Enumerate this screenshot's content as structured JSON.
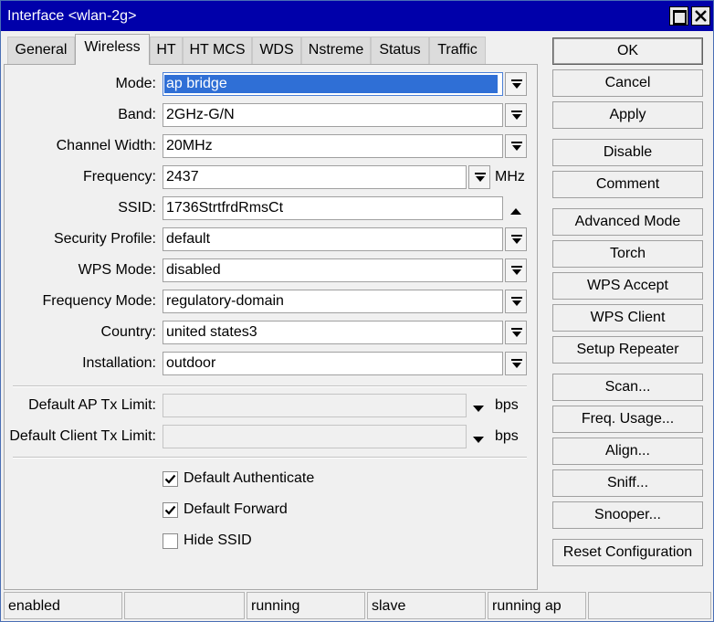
{
  "window": {
    "title": "Interface <wlan-2g>"
  },
  "tabs": [
    {
      "label": "General"
    },
    {
      "label": "Wireless"
    },
    {
      "label": "HT"
    },
    {
      "label": "HT MCS"
    },
    {
      "label": "WDS"
    },
    {
      "label": "Nstreme"
    },
    {
      "label": "Status"
    },
    {
      "label": "Traffic"
    }
  ],
  "active_tab": "Wireless",
  "form": {
    "mode": {
      "label": "Mode:",
      "value": "ap bridge"
    },
    "band": {
      "label": "Band:",
      "value": "2GHz-G/N"
    },
    "channel_width": {
      "label": "Channel Width:",
      "value": "20MHz"
    },
    "frequency": {
      "label": "Frequency:",
      "value": "2437",
      "unit": "MHz"
    },
    "ssid": {
      "label": "SSID:",
      "value": "1736StrtfrdRmsCt"
    },
    "security_profile": {
      "label": "Security Profile:",
      "value": "default"
    },
    "wps_mode": {
      "label": "WPS Mode:",
      "value": "disabled"
    },
    "frequency_mode": {
      "label": "Frequency Mode:",
      "value": "regulatory-domain"
    },
    "country": {
      "label": "Country:",
      "value": "united states3"
    },
    "installation": {
      "label": "Installation:",
      "value": "outdoor"
    },
    "default_ap_tx_limit": {
      "label": "Default AP Tx Limit:",
      "value": "",
      "unit": "bps"
    },
    "default_client_tx_limit": {
      "label": "Default Client Tx Limit:",
      "value": "",
      "unit": "bps"
    }
  },
  "checkboxes": {
    "default_authenticate": {
      "label": "Default Authenticate",
      "checked": true
    },
    "default_forward": {
      "label": "Default Forward",
      "checked": true
    },
    "hide_ssid": {
      "label": "Hide SSID",
      "checked": false
    }
  },
  "buttons": {
    "ok": "OK",
    "cancel": "Cancel",
    "apply": "Apply",
    "disable": "Disable",
    "comment": "Comment",
    "advanced_mode": "Advanced Mode",
    "torch": "Torch",
    "wps_accept": "WPS Accept",
    "wps_client": "WPS Client",
    "setup_repeater": "Setup Repeater",
    "scan": "Scan...",
    "freq_usage": "Freq. Usage...",
    "align": "Align...",
    "sniff": "Sniff...",
    "snooper": "Snooper...",
    "reset_configuration": "Reset Configuration"
  },
  "status_bar": [
    "enabled",
    "",
    "running",
    "slave",
    "running ap",
    ""
  ],
  "colors": {
    "title_bar": "#0000aa",
    "selection": "#2f6fd6",
    "background": "#f0f0f0"
  }
}
